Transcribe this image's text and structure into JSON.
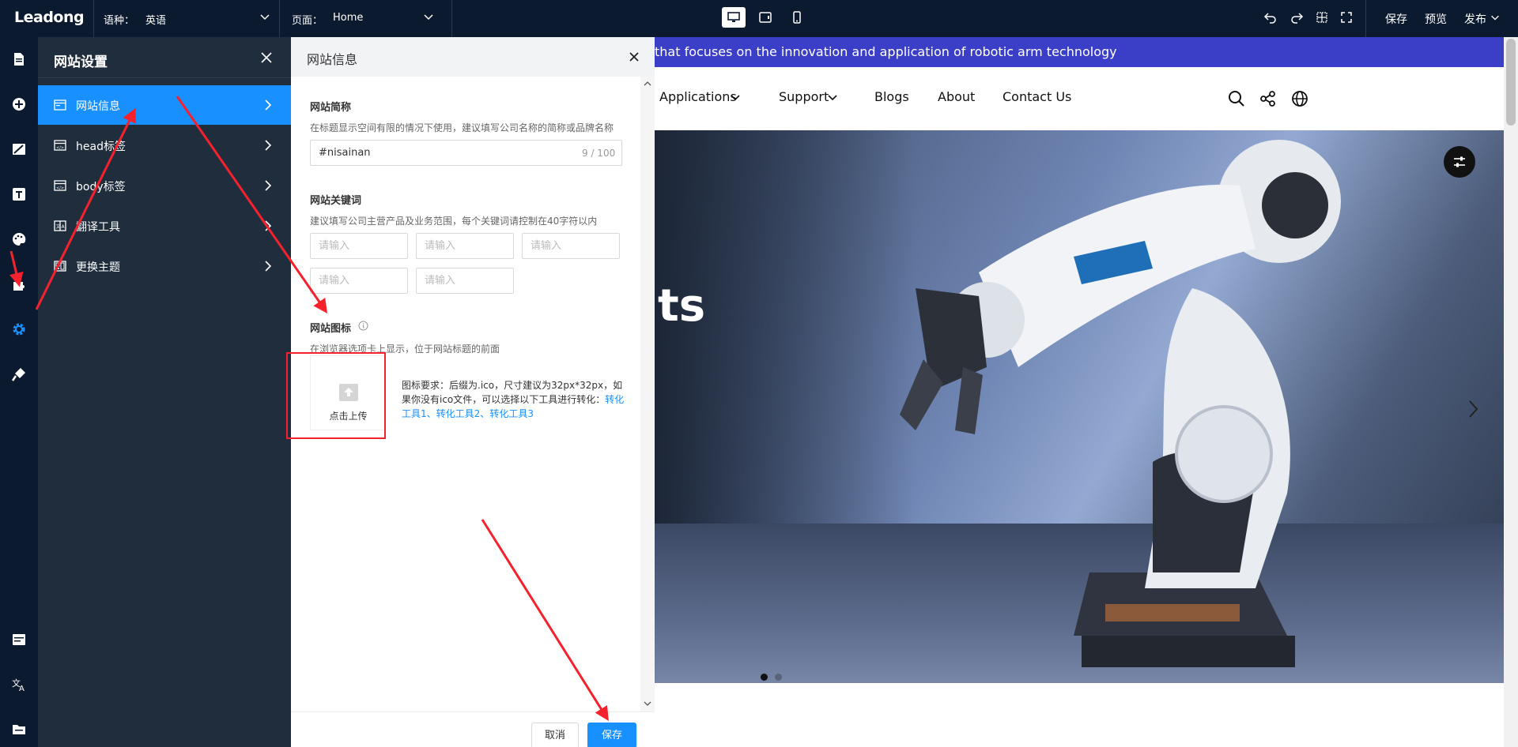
{
  "app": {
    "logo": "Leadong"
  },
  "topbar": {
    "language_label": "语种：",
    "language_value": "英语",
    "page_label": "页面：",
    "page_value": "Home",
    "save": "保存",
    "preview": "预览",
    "publish": "发布"
  },
  "settings_nav": {
    "title": "网站设置",
    "items": [
      {
        "label": "网站信息",
        "icon": "info-card-icon",
        "active": true
      },
      {
        "label": "head标签",
        "icon": "code-tag-icon",
        "active": false
      },
      {
        "label": "body标签",
        "icon": "code-tag-icon",
        "active": false
      },
      {
        "label": "翻译工具",
        "icon": "translate-icon",
        "active": false
      },
      {
        "label": "更换主题",
        "icon": "theme-icon",
        "active": false
      }
    ]
  },
  "dialog": {
    "title": "网站信息",
    "short_name": {
      "title": "网站简称",
      "desc": "在标题显示空间有限的情况下使用，建议填写公司名称的简称或品牌名称",
      "value": "#nisainan",
      "counter": "9 / 100"
    },
    "keywords": {
      "title": "网站关键词",
      "desc": "建议填写公司主营产品及业务范围，每个关键词请控制在40字符以内",
      "placeholder": "请输入"
    },
    "favicon": {
      "title": "网站图标",
      "desc": "在浏览器选项卡上显示，位于网站标题的前面",
      "upload": "点击上传",
      "requirement": "图标要求：后缀为.ico，尺寸建议为32px*32px，如果你没有ico文件，可以选择以下工具进行转化：",
      "link1": "转化工具1",
      "link2": "转化工具2",
      "link3": "转化工具3",
      "sep": "、"
    },
    "cancel": "取消",
    "save": "保存"
  },
  "preview": {
    "banner": "that focuses on the innovation and application of robotic arm technology",
    "nav": [
      "Applications",
      "Support",
      "Blogs",
      "About",
      "Contact Us"
    ],
    "hero_text": "ts",
    "colors": {
      "banner": "#3b3ec6",
      "accent": "#1890ff",
      "dark": "#0c1a30"
    }
  }
}
